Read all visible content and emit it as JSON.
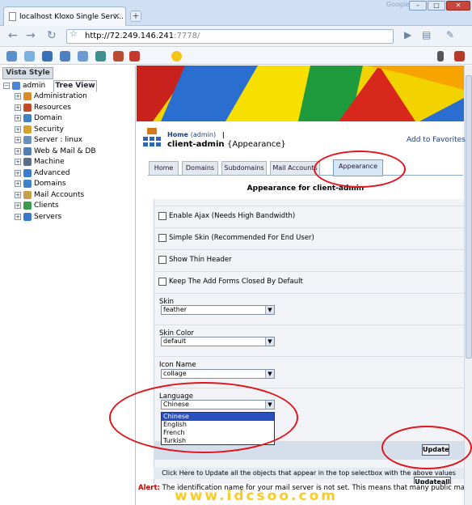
{
  "browser": {
    "tab_title": "localhost Kloxo Single Serv...",
    "search_hint": "Google",
    "address_host": "http://72.249.146.241",
    "address_port": ":7778/"
  },
  "leftpanel": {
    "tabs": [
      "Vista Style",
      "Tree View"
    ],
    "tree": [
      {
        "label": "admin",
        "root": true,
        "color": "#4a86d4"
      },
      {
        "label": "Administration",
        "color": "#d98a2a"
      },
      {
        "label": "Resources",
        "color": "#c04c2a"
      },
      {
        "label": "Domain",
        "color": "#3d83c6"
      },
      {
        "label": "Security",
        "color": "#d5a12a"
      },
      {
        "label": "Server  : linux",
        "color": "#6b8fb8"
      },
      {
        "label": "Web & Mail & DB",
        "color": "#4f7fb5"
      },
      {
        "label": "Machine",
        "color": "#5a6e8a"
      },
      {
        "label": "Advanced",
        "color": "#3a7dcf"
      },
      {
        "label": "Domains",
        "color": "#3d83c6"
      },
      {
        "label": "Mail Accounts",
        "color": "#c4a24a"
      },
      {
        "label": "Clients",
        "color": "#3b9a4e"
      },
      {
        "label": "Servers",
        "color": "#3a78c8"
      }
    ]
  },
  "header": {
    "breadcrumb_home": "Home",
    "breadcrumb_sub": "(admin)",
    "breadcrumb_sep": "|",
    "title_main": "client-admin",
    "title_sub": "{Appearance}",
    "favorites": "Add to Favorites"
  },
  "tabs": [
    "Home",
    "Domains",
    "Subdomains",
    "Mail Accounts",
    "Appearance"
  ],
  "section_title": "Appearance for client-admin",
  "options": [
    "Enable Ajax (Needs High Bandwidth)",
    "Simple Skin (Recommended For End User)",
    "Show Thin Header",
    "Keep The Add Forms Closed By Default"
  ],
  "fields": {
    "skin_label": "Skin",
    "skin_value": "feather",
    "skin_color_label": "Skin Color",
    "skin_color_value": "default",
    "icon_label": "Icon Name",
    "icon_value": "collage",
    "language_label": "Language",
    "language_value": "Chinese",
    "language_options": [
      "Chinese",
      "English",
      "French",
      "Turkish"
    ]
  },
  "buttons": {
    "update": "Update",
    "update_all": "Updateall"
  },
  "update_all_text": "Click Here to Update all the objects that appear in the top selectbox with the above values",
  "alert": {
    "label": "Alert:",
    "text": "The identification name for your mail server is not set. This means that many public mail servers like hotm"
  },
  "watermark": "www.idcsoo.com",
  "colors": {
    "annotation": "#e0141c",
    "link": "#1c3f7a",
    "alert": "#c80000"
  }
}
